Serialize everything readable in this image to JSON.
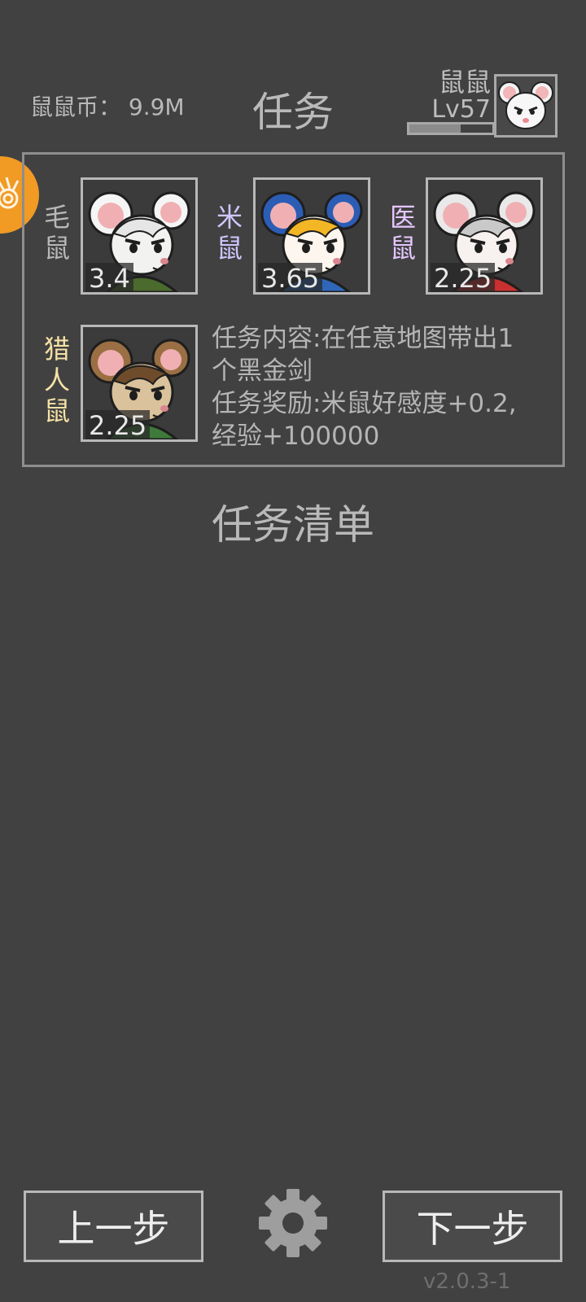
{
  "header": {
    "coins_label": "鼠鼠币： 9.9M",
    "title": "任务",
    "player_name": "鼠鼠",
    "player_level": "Lv57",
    "xp_progress": 0.62
  },
  "rats": [
    {
      "name_line1": "毛",
      "name_line2": "鼠",
      "affinity": "3.4",
      "name_color": "#b7b7b7",
      "fur": "#f2f2f0",
      "ear": "#f5f5f5",
      "hair": "#e6e6e6",
      "cloth": "#4b6a2e"
    },
    {
      "name_line1": "米",
      "name_line2": "鼠",
      "affinity": "3.65",
      "name_color": "#cfc6ff",
      "fur": "#fdf6ee",
      "ear": "#2c5db5",
      "hair": "#f3b624",
      "cloth": "#2f67b8"
    },
    {
      "name_line1": "医",
      "name_line2": "鼠",
      "affinity": "2.25",
      "name_color": "#e6c6ff",
      "fur": "#f7f1ef",
      "ear": "#e9e9e9",
      "hair": "#c9c9c9",
      "cloth": "#c9302f"
    },
    {
      "name_line1": "猎",
      "name_line2": "人",
      "name_line3": "鼠",
      "affinity": "2.25",
      "name_color": "#f6e2a6",
      "fur": "#d9c29c",
      "ear": "#9a6f43",
      "hair": "#6e4b2b",
      "cloth": "#3e7a3a"
    }
  ],
  "task": {
    "content_line1": "任务内容:在任意地图带出1",
    "content_line2": "个黑金剑",
    "reward_line1": "任务奖励:米鼠好感度+0.2,",
    "reward_line2": "经验+100000"
  },
  "list_title": "任务清单",
  "buttons": {
    "prev": "上一步",
    "next": "下一步"
  },
  "icons": {
    "settings": "gear-icon",
    "side_badge": "swirl-emblem-icon"
  },
  "version": "v2.0.3-1",
  "colors": {
    "background": "#414141",
    "accent_orange": "#f19a24"
  }
}
